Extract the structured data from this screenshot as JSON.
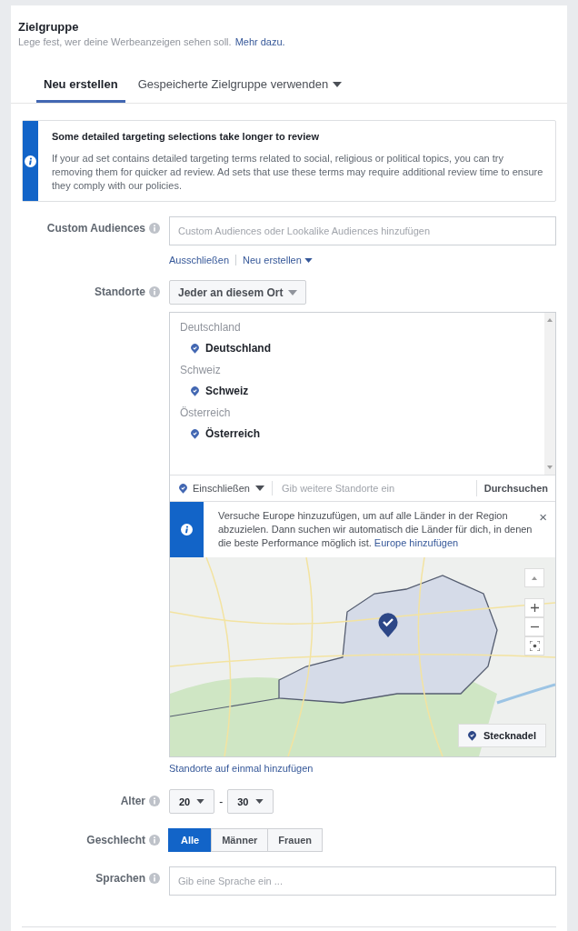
{
  "section": {
    "title": "Zielgruppe",
    "subtitle": "Lege fest, wer deine Werbeanzeigen sehen soll.",
    "learn_more": "Mehr dazu."
  },
  "tabs": [
    {
      "label": "Neu erstellen",
      "selected": true,
      "dropdown": false
    },
    {
      "label": "Gespeicherte Zielgruppe verwenden",
      "selected": false,
      "dropdown": true
    }
  ],
  "notice": {
    "title": "Some detailed targeting selections take longer to review",
    "body": "If your ad set contains detailed targeting terms related to social, religious or political topics, you can try removing them for quicker ad review. Ad sets that use these terms may require additional review time to ensure they comply with our policies."
  },
  "custom_audiences": {
    "label": "Custom Audiences",
    "placeholder": "Custom Audiences oder Lookalike Audiences hinzufügen",
    "links": [
      {
        "label": "Ausschließen",
        "dropdown": false
      },
      {
        "label": "Neu erstellen",
        "dropdown": true
      }
    ]
  },
  "locations": {
    "label": "Standorte",
    "mode": "Jeder an diesem Ort",
    "groups": [
      {
        "heading": "Deutschland",
        "item": "Deutschland"
      },
      {
        "heading": "Schweiz",
        "item": "Schweiz"
      },
      {
        "heading": "Österreich",
        "item": "Österreich"
      }
    ],
    "include": "Einschließen",
    "placeholder": "Gib weitere Standorte ein",
    "browse": "Durchsuchen",
    "tip": {
      "text": "Versuche Europe hinzuzufügen, um auf alle Länder in der Region abzuzielen. Dann suchen wir automatisch die Länder für dich, in denen die beste Performance möglich ist.",
      "link": "Europe hinzufügen",
      "close": "×"
    },
    "pin_button": "Stecknadel",
    "bulk_link": "Standorte auf einmal hinzufügen"
  },
  "age": {
    "label": "Alter",
    "from": "20",
    "separator": "-",
    "to": "30"
  },
  "gender": {
    "label": "Geschlecht",
    "options": [
      {
        "label": "Alle",
        "selected": true
      },
      {
        "label": "Männer",
        "selected": false
      },
      {
        "label": "Frauen",
        "selected": false
      }
    ]
  },
  "languages": {
    "label": "Sprachen",
    "placeholder": "Gib eine Sprache ein ..."
  }
}
